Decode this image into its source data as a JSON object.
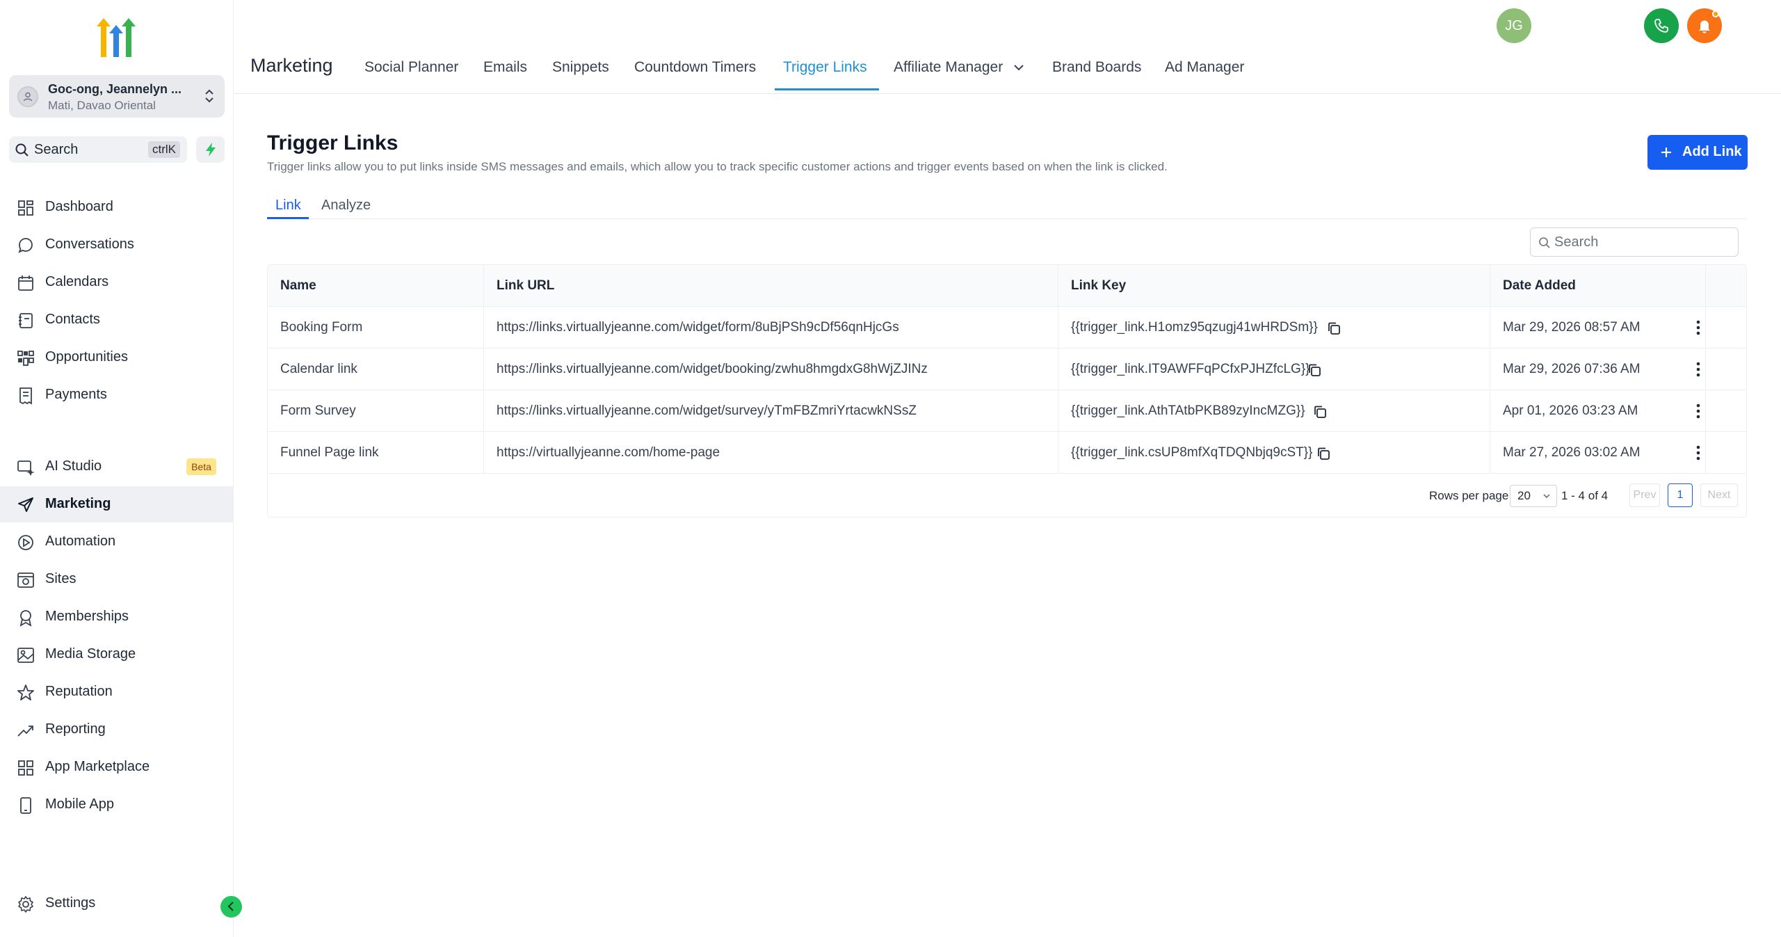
{
  "sidebar": {
    "account": {
      "name": "Goc-ong, Jeannelyn ...",
      "location": "Mati, Davao Oriental"
    },
    "search": {
      "label": "Search",
      "shortcut": "ctrlK"
    },
    "items": [
      {
        "label": "Dashboard",
        "icon": "dashboard-icon"
      },
      {
        "label": "Conversations",
        "icon": "chat-icon"
      },
      {
        "label": "Calendars",
        "icon": "calendar-icon"
      },
      {
        "label": "Contacts",
        "icon": "contacts-icon"
      },
      {
        "label": "Opportunities",
        "icon": "opportunities-icon"
      },
      {
        "label": "Payments",
        "icon": "payments-icon"
      },
      {
        "label": "AI Studio",
        "icon": "ai-studio-icon",
        "badge": "Beta"
      },
      {
        "label": "Marketing",
        "icon": "send-icon",
        "active": true
      },
      {
        "label": "Automation",
        "icon": "automation-icon"
      },
      {
        "label": "Sites",
        "icon": "sites-icon"
      },
      {
        "label": "Memberships",
        "icon": "award-icon"
      },
      {
        "label": "Media Storage",
        "icon": "image-icon"
      },
      {
        "label": "Reputation",
        "icon": "star-icon"
      },
      {
        "label": "Reporting",
        "icon": "trend-icon"
      },
      {
        "label": "App Marketplace",
        "icon": "grid-icon"
      },
      {
        "label": "Mobile App",
        "icon": "mobile-icon"
      },
      {
        "label": "Settings",
        "icon": "gear-icon"
      }
    ]
  },
  "header": {
    "title": "Marketing",
    "tabs": [
      {
        "label": "Social Planner"
      },
      {
        "label": "Emails"
      },
      {
        "label": "Snippets"
      },
      {
        "label": "Countdown Timers"
      },
      {
        "label": "Trigger Links",
        "active": true
      },
      {
        "label": "Affiliate Manager",
        "dropdown": true
      },
      {
        "label": "Brand Boards"
      },
      {
        "label": "Ad Manager"
      }
    ],
    "user_initials": "JG",
    "colors": {
      "phone": "#16a34a",
      "bell": "#f97316",
      "avatar": "#8fbe76"
    }
  },
  "page": {
    "title": "Trigger Links",
    "description": "Trigger links allow you to put links inside SMS messages and emails, which allow you to track specific customer actions and trigger events based on when the link is clicked.",
    "add_button": "Add Link",
    "subtabs": [
      "Link",
      "Analyze"
    ],
    "search_placeholder": "Search"
  },
  "table": {
    "columns": [
      "Name",
      "Link URL",
      "Link Key",
      "Date Added"
    ],
    "rows": [
      {
        "name": "Booking Form",
        "url": "https://links.virtuallyjeanne.com/widget/form/8uBjPSh9cDf56qnHjcGs",
        "key": "{{trigger_link.H1omz95qzugj41wHRDSm}}",
        "date": "Mar 29, 2026 08:57 AM"
      },
      {
        "name": "Calendar link",
        "url": "https://links.virtuallyjeanne.com/widget/booking/zwhu8hmgdxG8hWjZJINz",
        "key": "{{trigger_link.IT9AWFFqPCfxPJHZfcLG}}",
        "date": "Mar 29, 2026 07:36 AM"
      },
      {
        "name": "Form Survey",
        "url": "https://links.virtuallyjeanne.com/widget/survey/yTmFBZmriYrtacwkNSsZ",
        "key": "{{trigger_link.AthTAtbPKB89zyIncMZG}}",
        "date": "Apr 01, 2026 03:23 AM"
      },
      {
        "name": "Funnel Page link",
        "url": "https://virtuallyjeanne.com/home-page",
        "key": "{{trigger_link.csUP8mfXqTDQNbjq9cST}}",
        "date": "Mar 27, 2026 03:02 AM"
      }
    ],
    "pagination": {
      "rows_per_page_label": "Rows per page",
      "rows_per_page": "20",
      "range": "1 - 4 of 4",
      "prev": "Prev",
      "page": "1",
      "next": "Next"
    }
  },
  "accent_colors": {
    "primary": "#155eef",
    "tab_active": "#1d8fd6",
    "beta_bg": "#fde68a"
  }
}
